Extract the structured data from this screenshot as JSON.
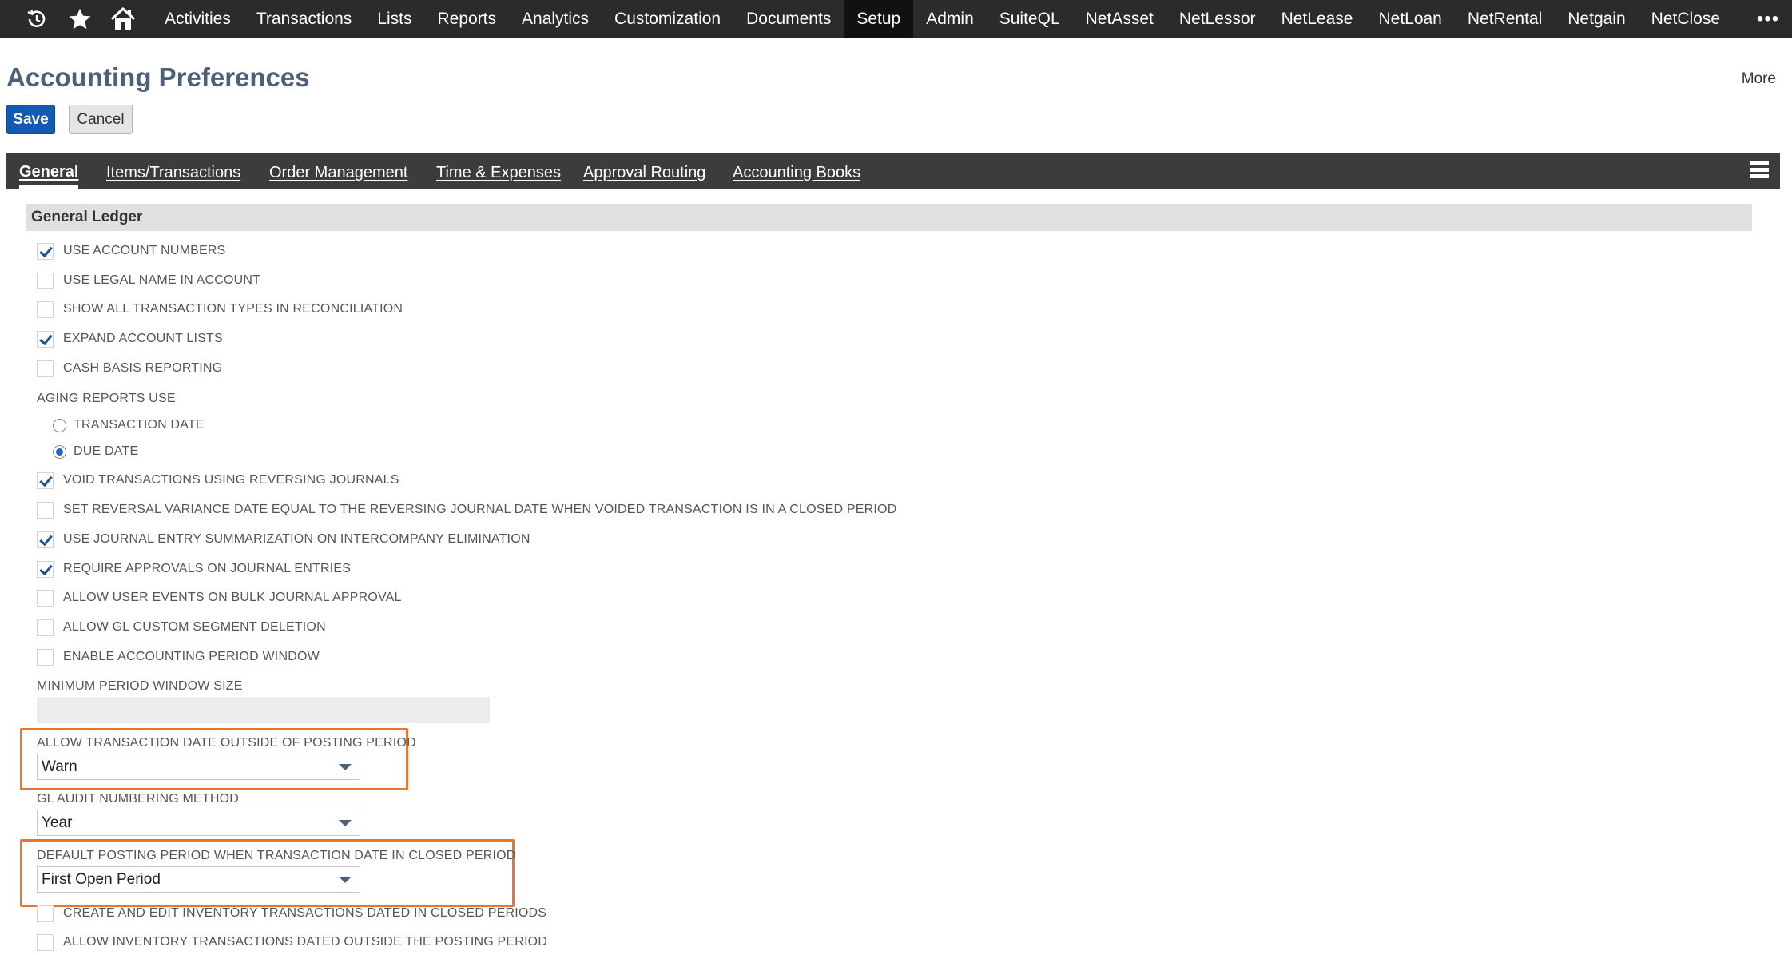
{
  "nav": {
    "items": [
      "Activities",
      "Transactions",
      "Lists",
      "Reports",
      "Analytics",
      "Customization",
      "Documents",
      "Setup",
      "Admin",
      "SuiteQL",
      "NetAsset",
      "NetLessor",
      "NetLease",
      "NetLoan",
      "NetRental",
      "Netgain",
      "NetClose"
    ],
    "active": "Setup",
    "more_glyph": "•••"
  },
  "page": {
    "title": "Accounting Preferences",
    "more_label": "More",
    "save_label": "Save",
    "cancel_label": "Cancel"
  },
  "tabs": [
    "General",
    "Items/Transactions",
    "Order Management",
    "Time & Expenses",
    "Approval Routing",
    "Accounting Books"
  ],
  "section": {
    "title": "General Ledger",
    "use_account_numbers": {
      "label": "USE ACCOUNT NUMBERS",
      "checked": true
    },
    "use_legal_name": {
      "label": "USE LEGAL NAME IN ACCOUNT",
      "checked": false
    },
    "show_all_types": {
      "label": "SHOW ALL TRANSACTION TYPES IN RECONCILIATION",
      "checked": false
    },
    "expand_account_lists": {
      "label": "EXPAND ACCOUNT LISTS",
      "checked": true
    },
    "cash_basis": {
      "label": "CASH BASIS REPORTING",
      "checked": false
    },
    "aging_label": "AGING REPORTS USE",
    "aging_transaction_date": {
      "label": "TRANSACTION DATE",
      "selected": false
    },
    "aging_due_date": {
      "label": "DUE DATE",
      "selected": true
    },
    "void_reversing": {
      "label": "VOID TRANSACTIONS USING REVERSING JOURNALS",
      "checked": true
    },
    "reversal_variance": {
      "label": "SET REVERSAL VARIANCE DATE EQUAL TO THE REVERSING JOURNAL DATE WHEN VOIDED TRANSACTION IS IN A CLOSED PERIOD",
      "checked": false
    },
    "je_summarization": {
      "label": "USE JOURNAL ENTRY SUMMARIZATION ON INTERCOMPANY ELIMINATION",
      "checked": true
    },
    "require_approvals": {
      "label": "REQUIRE APPROVALS ON JOURNAL ENTRIES",
      "checked": true
    },
    "user_events_bulk": {
      "label": "ALLOW USER EVENTS ON BULK JOURNAL APPROVAL",
      "checked": false
    },
    "gl_segment_deletion": {
      "label": "ALLOW GL CUSTOM SEGMENT DELETION",
      "checked": false
    },
    "period_window": {
      "label": "ENABLE ACCOUNTING PERIOD WINDOW",
      "checked": false
    },
    "min_period_window_label": "MINIMUM PERIOD WINDOW SIZE",
    "allow_outside_posting": {
      "label": "ALLOW TRANSACTION DATE OUTSIDE OF POSTING PERIOD",
      "value": "Warn"
    },
    "gl_audit_numbering": {
      "label": "GL AUDIT NUMBERING METHOD",
      "value": "Year"
    },
    "default_posting_period": {
      "label": "DEFAULT POSTING PERIOD WHEN TRANSACTION DATE IN CLOSED PERIOD",
      "value": "First Open Period"
    },
    "create_edit_inventory": {
      "label": "CREATE AND EDIT INVENTORY TRANSACTIONS DATED IN CLOSED PERIODS",
      "checked": false
    },
    "allow_inventory_outside": {
      "label": "ALLOW INVENTORY TRANSACTIONS DATED OUTSIDE THE POSTING PERIOD",
      "checked": false
    }
  },
  "colors": {
    "nav_bg": "#2b2b2b",
    "title": "#4d5f79",
    "save_btn": "#125ab2",
    "highlight": "#e8742f"
  }
}
